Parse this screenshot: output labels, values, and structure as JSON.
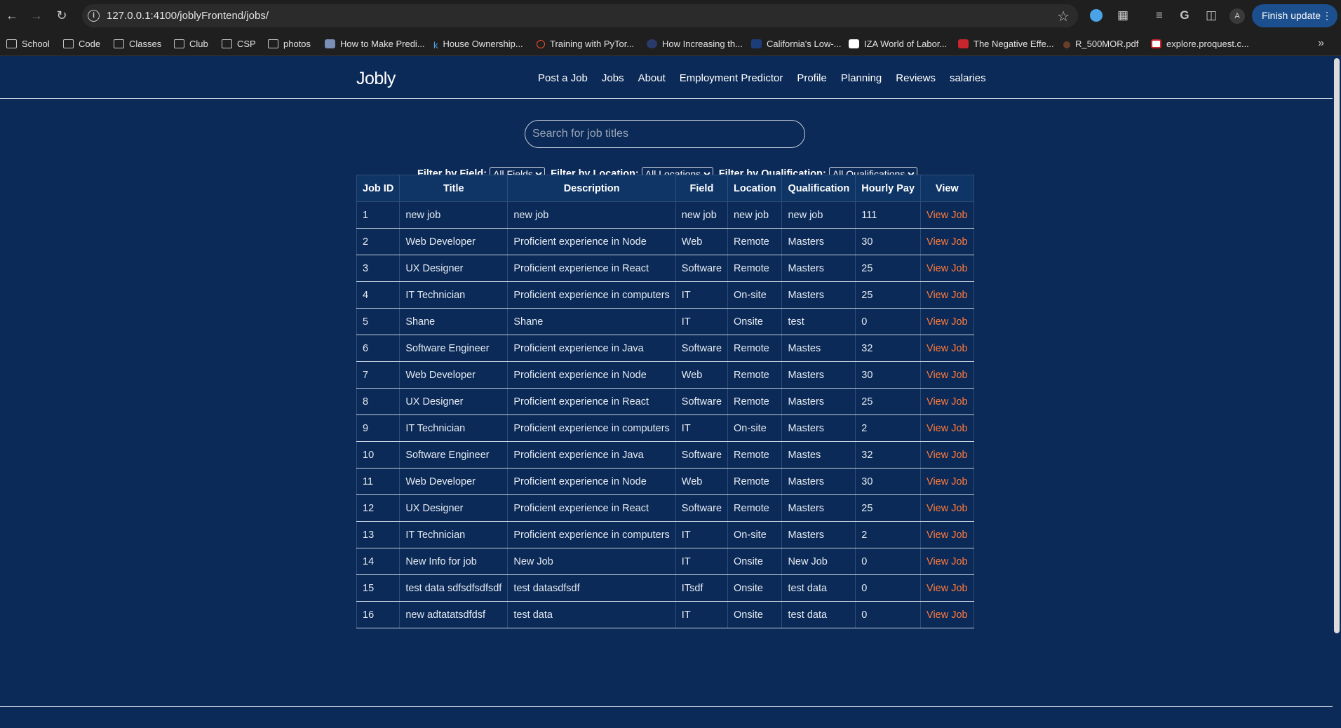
{
  "browser": {
    "url": "127.0.0.1:4100/joblyFrontend/jobs/",
    "profile_initial": "A",
    "update_label": "Finish update",
    "bookmarks": [
      {
        "label": "School",
        "type": "folder"
      },
      {
        "label": "Code",
        "type": "folder"
      },
      {
        "label": "Classes",
        "type": "folder"
      },
      {
        "label": "Club",
        "type": "folder"
      },
      {
        "label": "CSP",
        "type": "folder"
      },
      {
        "label": "photos",
        "type": "folder"
      },
      {
        "label": "How to Make Predi...",
        "type": "page"
      },
      {
        "label": "House Ownership...",
        "type": "page"
      },
      {
        "label": "Training with PyTor...",
        "type": "page"
      },
      {
        "label": "How Increasing th...",
        "type": "page"
      },
      {
        "label": "California's Low-...",
        "type": "page"
      },
      {
        "label": "IZA World of Labor...",
        "type": "page"
      },
      {
        "label": "The Negative Effe...",
        "type": "page"
      },
      {
        "label": "R_500MOR.pdf",
        "type": "page"
      },
      {
        "label": "explore.proquest.c...",
        "type": "page"
      }
    ]
  },
  "site": {
    "brand": "Jobly",
    "nav": [
      "Post a Job",
      "Jobs",
      "About",
      "Employment Predictor",
      "Profile",
      "Planning",
      "Reviews",
      "salaries"
    ],
    "search_placeholder": "Search for job titles",
    "filters": {
      "field_label": "Filter by Field:",
      "field_value": "All Fields",
      "location_label": "Filter by Location:",
      "location_value": "All Locations",
      "qualification_label": "Filter by Qualification:",
      "qualification_value": "All Qualifications"
    },
    "table": {
      "headers": [
        "Job ID",
        "Title",
        "Description",
        "Field",
        "Location",
        "Qualification",
        "Hourly Pay",
        "View"
      ],
      "link_label": "View Job",
      "rows": [
        [
          "1",
          "new job",
          "new job",
          "new job",
          "new job",
          "new job",
          "111"
        ],
        [
          "2",
          "Web Developer",
          "Proficient experience in Node",
          "Web",
          "Remote",
          "Masters",
          "30"
        ],
        [
          "3",
          "UX Designer",
          "Proficient experience in React",
          "Software",
          "Remote",
          "Masters",
          "25"
        ],
        [
          "4",
          "IT Technician",
          "Proficient experience in computers",
          "IT",
          "On-site",
          "Masters",
          "25"
        ],
        [
          "5",
          "Shane",
          "Shane",
          "IT",
          "Onsite",
          "test",
          "0"
        ],
        [
          "6",
          "Software Engineer",
          "Proficient experience in Java",
          "Software",
          "Remote",
          "Mastes",
          "32"
        ],
        [
          "7",
          "Web Developer",
          "Proficient experience in Node",
          "Web",
          "Remote",
          "Masters",
          "30"
        ],
        [
          "8",
          "UX Designer",
          "Proficient experience in React",
          "Software",
          "Remote",
          "Masters",
          "25"
        ],
        [
          "9",
          "IT Technician",
          "Proficient experience in computers",
          "IT",
          "On-site",
          "Masters",
          "2"
        ],
        [
          "10",
          "Software Engineer",
          "Proficient experience in Java",
          "Software",
          "Remote",
          "Mastes",
          "32"
        ],
        [
          "11",
          "Web Developer",
          "Proficient experience in Node",
          "Web",
          "Remote",
          "Masters",
          "30"
        ],
        [
          "12",
          "UX Designer",
          "Proficient experience in React",
          "Software",
          "Remote",
          "Masters",
          "25"
        ],
        [
          "13",
          "IT Technician",
          "Proficient experience in computers",
          "IT",
          "On-site",
          "Masters",
          "2"
        ],
        [
          "14",
          "New Info for job",
          "New Job",
          "IT",
          "Onsite",
          "New Job",
          "0"
        ],
        [
          "15",
          "test data sdfsdfsdfsdf",
          "test datasdfsdf",
          "ITsdf",
          "Onsite",
          "test data",
          "0"
        ],
        [
          "16",
          "new adtatatsdfdsf",
          "test data",
          "IT",
          "Onsite",
          "test data",
          "0"
        ]
      ]
    }
  },
  "colors": {
    "page_bg": "#0b2a57",
    "link": "#ff7b3d",
    "chrome_bg": "#1f1f1f",
    "update_button": "#1b4f8d"
  }
}
